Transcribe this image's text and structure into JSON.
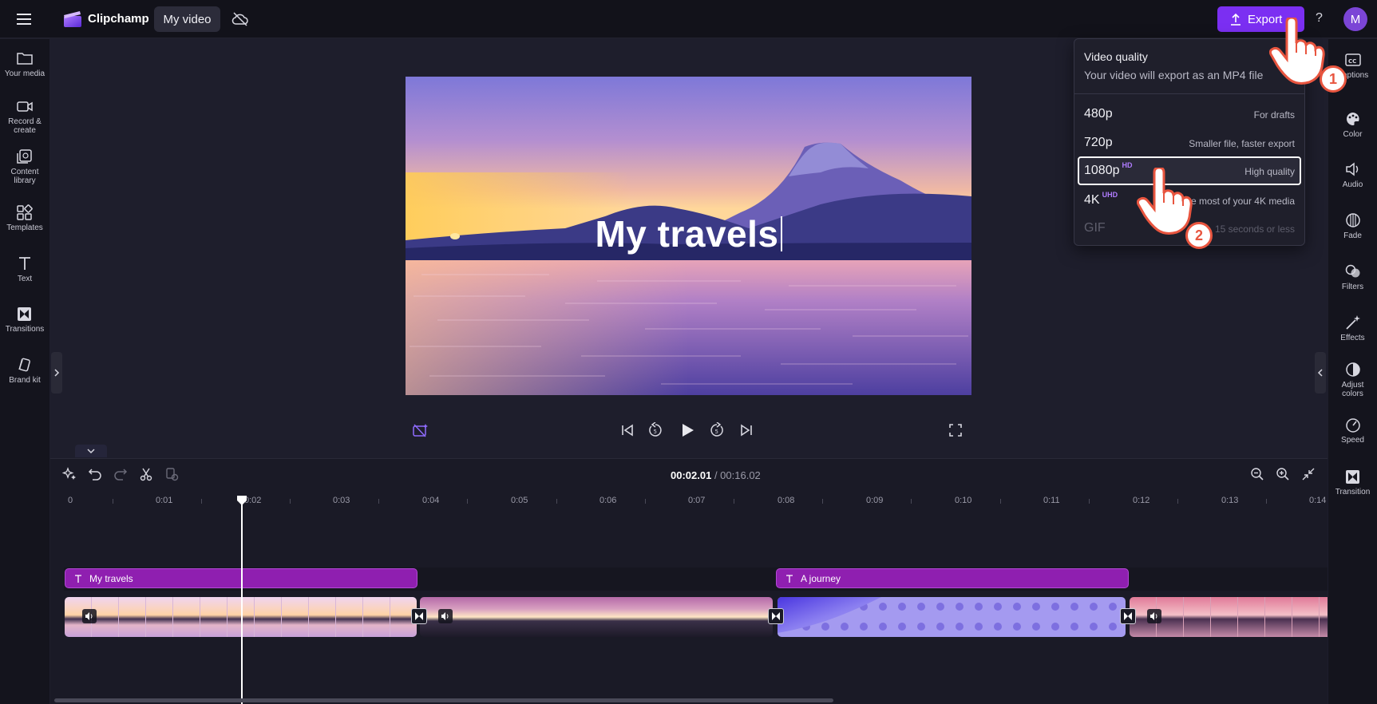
{
  "app": {
    "name": "Clipchamp",
    "project_title": "My video"
  },
  "toolbar": {
    "export_label": "Export",
    "help_label": "?",
    "avatar_initial": "M"
  },
  "left_sidebar": {
    "items": [
      {
        "label": "Your media",
        "icon": "folder-icon"
      },
      {
        "label": "Record & create",
        "icon": "camera-icon"
      },
      {
        "label": "Content library",
        "icon": "library-icon"
      },
      {
        "label": "Templates",
        "icon": "templates-icon"
      },
      {
        "label": "Text",
        "icon": "text-icon"
      },
      {
        "label": "Transitions",
        "icon": "transitions-icon"
      },
      {
        "label": "Brand kit",
        "icon": "brand-kit-icon"
      }
    ]
  },
  "right_sidebar": {
    "items": [
      {
        "label": "Captions",
        "icon": "captions-icon"
      },
      {
        "label": "Color",
        "icon": "palette-icon"
      },
      {
        "label": "Audio",
        "icon": "speaker-icon"
      },
      {
        "label": "Fade",
        "icon": "fade-icon"
      },
      {
        "label": "Filters",
        "icon": "filters-icon"
      },
      {
        "label": "Effects",
        "icon": "magic-wand-icon"
      },
      {
        "label": "Adjust colors",
        "icon": "contrast-icon"
      },
      {
        "label": "Speed",
        "icon": "speedometer-icon"
      },
      {
        "label": "Transition",
        "icon": "transition-icon"
      }
    ]
  },
  "preview": {
    "overlay_text": "My travels"
  },
  "export_menu": {
    "title": "Video quality",
    "subtitle": "Your video will export as an MP4 file",
    "options": [
      {
        "resolution": "480p",
        "badge": "",
        "description": "For drafts",
        "state": "normal"
      },
      {
        "resolution": "720p",
        "badge": "",
        "description": "Smaller file, faster export",
        "state": "normal"
      },
      {
        "resolution": "1080p",
        "badge": "HD",
        "description": "High quality",
        "state": "selected"
      },
      {
        "resolution": "4K",
        "badge": "UHD",
        "description": "e most of your 4K media",
        "state": "normal"
      },
      {
        "resolution": "GIF",
        "badge": "",
        "description": "15 seconds or less",
        "state": "disabled"
      }
    ]
  },
  "timeline": {
    "current_time": "00:02.01",
    "separator": " / ",
    "total_time": "00:16.02",
    "ruler": [
      "0",
      "0:01",
      "0:02",
      "0:03",
      "0:04",
      "0:05",
      "0:06",
      "0:07",
      "0:08",
      "0:09",
      "0:10",
      "0:11",
      "0:12",
      "0:13",
      "0:14"
    ],
    "text_clips": [
      {
        "label": "My travels"
      },
      {
        "label": "A journey"
      }
    ]
  },
  "annotations": {
    "step_1": "1",
    "step_2": "2"
  },
  "colors": {
    "accent": "#7b2ff2",
    "text_clip": "#8f1fb0",
    "step_badge": "#e8553f"
  }
}
